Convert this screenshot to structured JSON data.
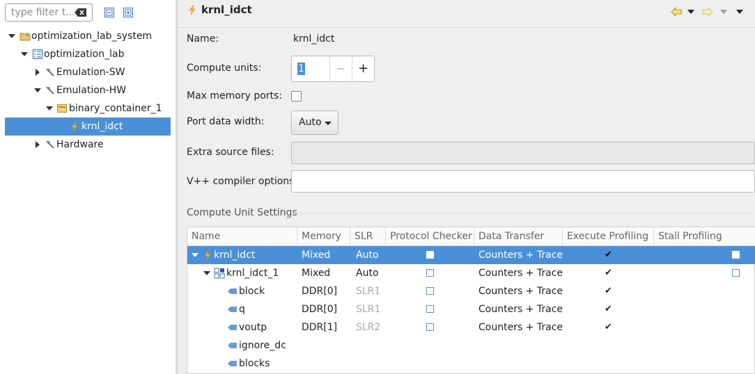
{
  "filter": {
    "placeholder": "type filter t..."
  },
  "tree": {
    "items": [
      {
        "label": "optimization_lab_system"
      },
      {
        "label": "optimization_lab"
      },
      {
        "label": "Emulation-SW"
      },
      {
        "label": "Emulation-HW"
      },
      {
        "label": "binary_container_1"
      },
      {
        "label": "krnl_idct"
      },
      {
        "label": "Hardware"
      }
    ]
  },
  "editor": {
    "title": "krnl_idct",
    "form": {
      "name_label": "Name:",
      "name_value": "krnl_idct",
      "compute_units_label": "Compute units:",
      "compute_units_value": "1",
      "minus": "−",
      "plus": "+",
      "max_memory_ports_label": "Max memory ports:",
      "port_data_width_label": "Port data width:",
      "port_data_width_value": "Auto",
      "extra_source_files_label": "Extra source files:",
      "vpp_compiler_options_label": "V++ compiler options:"
    },
    "section_title": "Compute Unit Settings",
    "table": {
      "headers": [
        "Name",
        "Memory",
        "SLR",
        "Protocol Checker",
        "Data Transfer",
        "Execute Profiling",
        "Stall Profiling"
      ],
      "rows": [
        {
          "name": "krnl_idct",
          "memory": "Mixed",
          "slr": "Auto",
          "data_transfer": "Counters + Trace"
        },
        {
          "name": "krnl_idct_1",
          "memory": "Mixed",
          "slr": "Auto",
          "data_transfer": "Counters + Trace"
        },
        {
          "name": "block",
          "memory": "DDR[0]",
          "slr": "SLR1",
          "data_transfer": "Counters + Trace"
        },
        {
          "name": "q",
          "memory": "DDR[0]",
          "slr": "SLR1",
          "data_transfer": "Counters + Trace"
        },
        {
          "name": "voutp",
          "memory": "DDR[1]",
          "slr": "SLR2",
          "data_transfer": "Counters + Trace"
        },
        {
          "name": "ignore_dc"
        },
        {
          "name": "blocks"
        }
      ]
    }
  },
  "colors": {
    "selection": "#4a90d9",
    "panel_bg": "#efefef"
  },
  "icons": [
    "clear-filter-icon",
    "collapse-all-icon",
    "expand-all-icon",
    "system-project-icon",
    "project-icon",
    "hammer-icon",
    "container-icon",
    "kernel-icon",
    "back-icon",
    "forward-icon",
    "menu-icon",
    "compute-unit-icon",
    "port-icon"
  ]
}
